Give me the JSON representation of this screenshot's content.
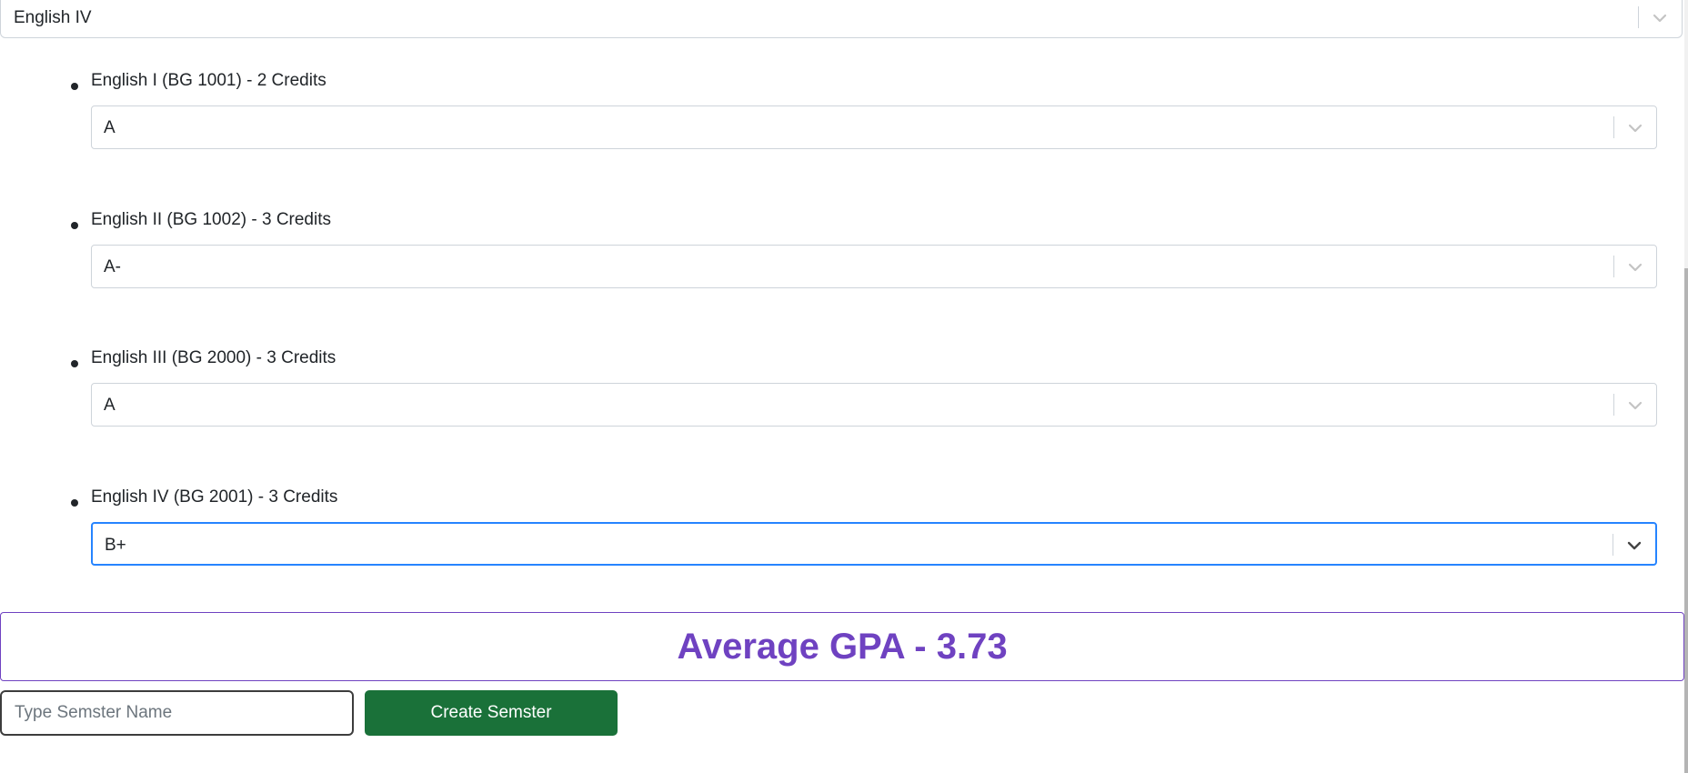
{
  "course_select": {
    "value": "English IV",
    "icon": "chevron-down-icon"
  },
  "courses": [
    {
      "label": "English I (BG 1001) - 2 Credits",
      "grade": "A"
    },
    {
      "label": "English II (BG 1002) - 3 Credits",
      "grade": "A-"
    },
    {
      "label": "English III (BG 2000) - 3 Credits",
      "grade": "A"
    },
    {
      "label": "English IV (BG 2001) - 3 Credits",
      "grade": "B+"
    }
  ],
  "gpa": {
    "text": "Average GPA - 3.73",
    "color": "#6f42c1"
  },
  "semester": {
    "placeholder": "Type Semster Name",
    "button_label": "Create Semster",
    "button_color": "#1a7139"
  },
  "colors": {
    "focus_border": "#2684ff",
    "border": "#ced4da"
  }
}
